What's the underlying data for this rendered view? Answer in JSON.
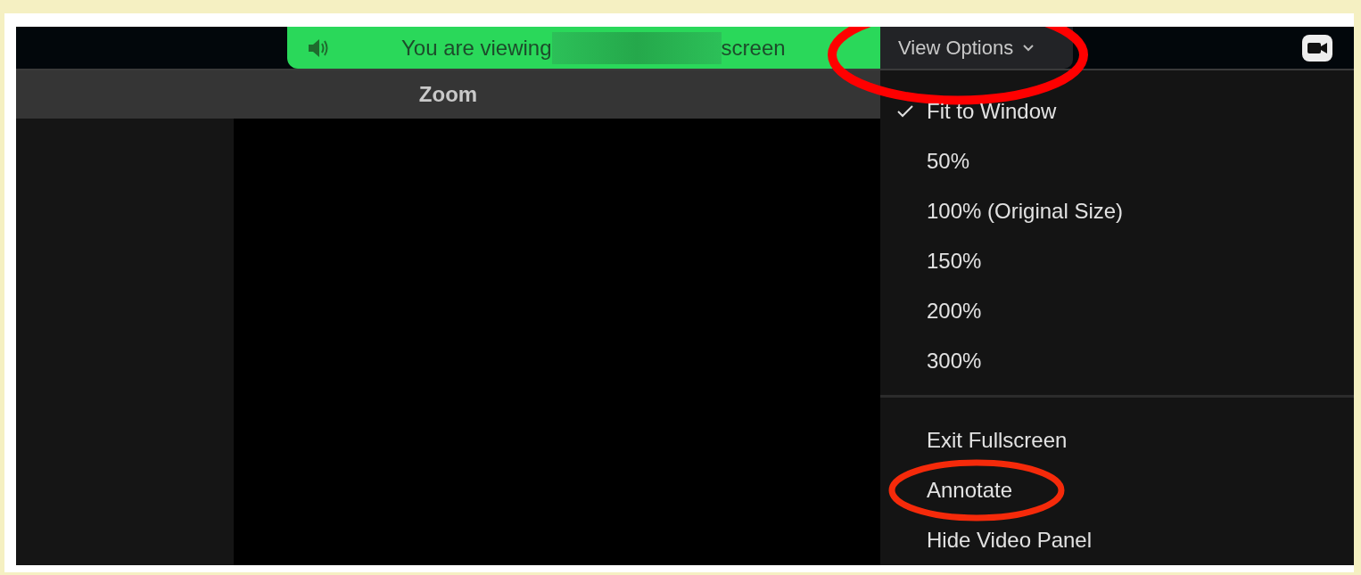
{
  "share_banner": {
    "text_before": "You are viewing",
    "redacted": true,
    "text_after": "screen"
  },
  "view_options": {
    "label": "View Options",
    "highlighted": true
  },
  "window": {
    "title": "Zoom"
  },
  "menu": {
    "items": [
      {
        "kind": "item",
        "label": "Fit to Window",
        "checked": true,
        "highlighted": false
      },
      {
        "kind": "item",
        "label": "50%",
        "checked": false,
        "highlighted": false
      },
      {
        "kind": "item",
        "label": "100% (Original Size)",
        "checked": false,
        "highlighted": false
      },
      {
        "kind": "item",
        "label": "150%",
        "checked": false,
        "highlighted": false
      },
      {
        "kind": "item",
        "label": "200%",
        "checked": false,
        "highlighted": false
      },
      {
        "kind": "item",
        "label": "300%",
        "checked": false,
        "highlighted": false
      },
      {
        "kind": "separator"
      },
      {
        "kind": "item",
        "label": "Exit Fullscreen",
        "checked": false,
        "highlighted": false
      },
      {
        "kind": "item",
        "label": "Annotate",
        "checked": false,
        "highlighted": true
      },
      {
        "kind": "item",
        "label": "Hide Video Panel",
        "checked": false,
        "highlighted": false
      }
    ]
  }
}
